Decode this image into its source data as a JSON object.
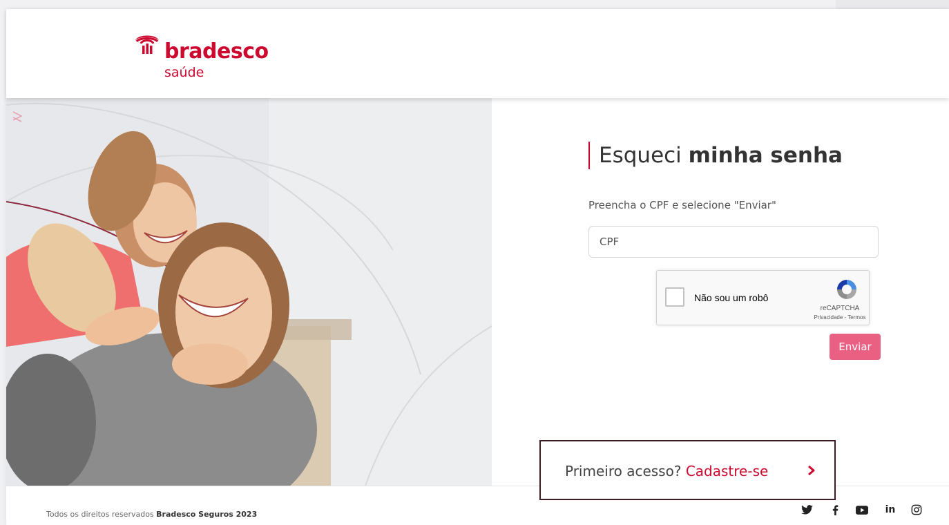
{
  "brand": {
    "name": "bradesco",
    "sub": "saúde",
    "color": "#cc092f"
  },
  "form": {
    "title_light": "Esqueci",
    "title_bold": "minha senha",
    "instruction": "Preencha o CPF e selecione \"Enviar\"",
    "cpf_placeholder": "CPF",
    "cpf_value": "",
    "captcha": {
      "checked": false,
      "label": "Não sou um robô",
      "brand": "reCAPTCHA",
      "privacy": "Privacidade",
      "separator": " - ",
      "terms": "Termos"
    },
    "submit_label": "Enviar",
    "submit_color": "#ea6083"
  },
  "first_access": {
    "question": "Primeiro acesso?",
    "link": "Cadastre-se"
  },
  "footer": {
    "rights": "Todos os direitos reservados",
    "company": "Bradesco Seguros 2023",
    "social": [
      "twitter-icon",
      "facebook-icon",
      "youtube-icon",
      "linkedin-icon",
      "instagram-icon"
    ]
  }
}
